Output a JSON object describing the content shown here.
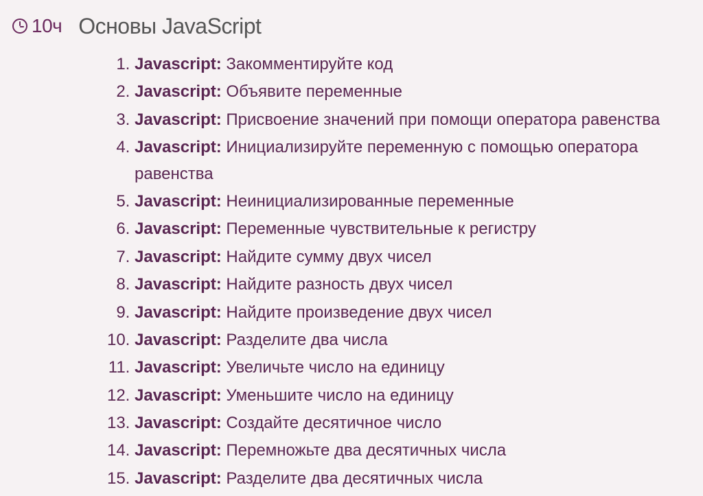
{
  "header": {
    "duration": "10ч",
    "title": "Основы JavaScript"
  },
  "lessons": [
    {
      "prefix": "Javascript:",
      "desc": "Закомментируйте код"
    },
    {
      "prefix": "Javascript:",
      "desc": "Объявите переменные"
    },
    {
      "prefix": "Javascript:",
      "desc": "Присвоение значений при помощи оператора равенства"
    },
    {
      "prefix": "Javascript:",
      "desc": "Инициализируйте переменную с помощью оператора равенства"
    },
    {
      "prefix": "Javascript:",
      "desc": "Неинициализированные переменные"
    },
    {
      "prefix": "Javascript:",
      "desc": "Переменные чувствительные к регистру"
    },
    {
      "prefix": "Javascript:",
      "desc": "Найдите сумму двух чисел"
    },
    {
      "prefix": "Javascript:",
      "desc": "Найдите разность двух чисел"
    },
    {
      "prefix": "Javascript:",
      "desc": "Найдите произведение двух чисел"
    },
    {
      "prefix": "Javascript:",
      "desc": "Разделите два числа"
    },
    {
      "prefix": "Javascript:",
      "desc": "Увеличьте число на единицу"
    },
    {
      "prefix": "Javascript:",
      "desc": "Уменьшите число на единицу"
    },
    {
      "prefix": "Javascript:",
      "desc": "Создайте десятичное число"
    },
    {
      "prefix": "Javascript:",
      "desc": "Перемножьте два десятичных числа"
    },
    {
      "prefix": "Javascript:",
      "desc": "Разделите два десятичных числа"
    }
  ]
}
